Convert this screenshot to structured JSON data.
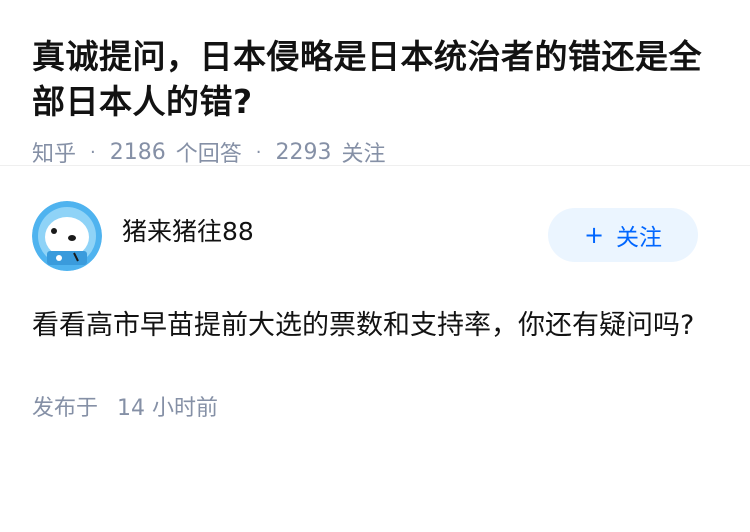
{
  "question": {
    "title": "真诚提问，日本侵略是日本统治者的错还是全部日本人的错?",
    "source": "知乎",
    "answer_count": "2186",
    "answer_label": "个回答",
    "follower_count": "2293",
    "follower_label": "关注"
  },
  "answer": {
    "author_name": "猪来猪往88",
    "follow_button": "关注",
    "follow_icon": "plus-icon",
    "content": "看看高市早苗提前大选的票数和支持率，你还有疑问吗?",
    "published_label": "发布于",
    "published_time": "14 小时前"
  },
  "colors": {
    "accent": "#0066ff",
    "button_bg": "#ebf5ff",
    "meta": "#8590a6",
    "avatar_bg": "#4fb3ef"
  }
}
